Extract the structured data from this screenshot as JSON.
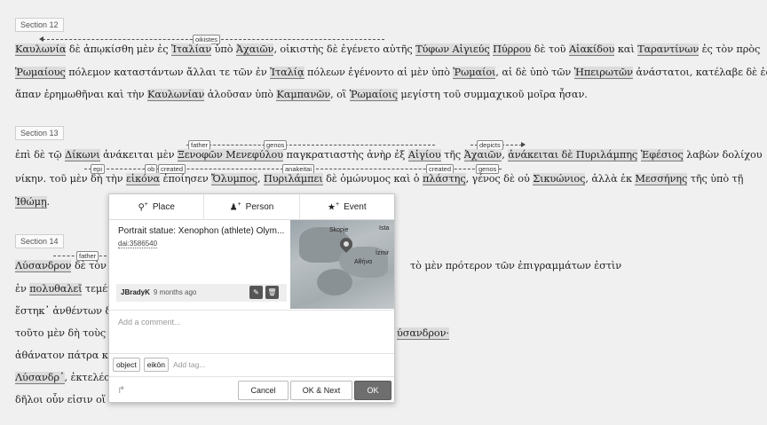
{
  "sections": [
    {
      "label": "Section 12"
    },
    {
      "label": "Section 13"
    },
    {
      "label": "Section 14"
    }
  ],
  "s12": {
    "l1": {
      "w1": "Καυλωνία",
      "t1": " δὲ ἀπῳκίσθη μὲν ἐς ",
      "w2": "Ἰταλίαν",
      "t2": " ὑπὸ ",
      "w3": "Ἀχαιῶν",
      "t3": ", οἰκιστὴς δὲ ἐγένετο αὐτῆς ",
      "w4": "Τύφων Αἰγιεύς",
      "t4": " ",
      "w5": "Πύρρου",
      "t5": " δὲ τοῦ ",
      "w6": "Αἰακίδου",
      "t6": " καὶ ",
      "w7": "Ταραντίνων",
      "t7": " ἐς τὸν πρὸς"
    },
    "l2": {
      "w1": "Ῥωμαίους",
      "t1": " πόλεμον καταστάντων ἄλλαι τε τῶν ἐν ",
      "w2": "Ἰταλίᾳ",
      "t2": " πόλεων ἐγένοντο αἱ μὲν ὑπὸ ",
      "w3": "Ῥωμαίοι",
      "t3": ", αἱ δὲ ὑπὸ τῶν ",
      "w4": "Ἠπειρωτῶν",
      "t4": " ἀνάστατοι, κατέλαβε δὲ ἐς"
    },
    "l3": {
      "t0": "ἅπαν ἐρημωθῆναι καὶ τὴν ",
      "w1": "Καυλωνίαν",
      "t1": " ἁλοῦσαν ὑπὸ ",
      "w2": "Καμπανῶν",
      "t2": ", οἳ ",
      "w3": "Ῥωμαίοις",
      "t3": " μεγίστη τοῦ συμμαχικοῦ μοῖρα ἦσαν."
    },
    "tag": "oikistes"
  },
  "s13": {
    "l1": {
      "t0": "ἐπὶ δὲ τῷ ",
      "w1": "Δίκωνι",
      "t1": " ἀνάκειται μὲν ",
      "w2": "Ξενοφῶν Μενεφύλου",
      "t2": " παγκρατιαστὴς ἀνὴρ ἐξ ",
      "w3": "Αἰγίου",
      "t3": " τῆς ",
      "w4": "Ἀχαιῶν",
      "t4": ", ",
      "w5": "ἀνάκειται δὲ Πυριλάμπης",
      "t5": " ",
      "w6": "Ἐφέσιος",
      "t6": " λαβὼν δολίχου"
    },
    "l2": {
      "t0": "νίκην. τοῦ μὲν δὴ τὴν ",
      "w1": "εἰκόνα",
      "t1": " ἐποίησεν ",
      "w2": "Ὄλυμπος",
      "t2": ", ",
      "w3": "Πυριλάμπει",
      "t3": " δὲ ὁμώνυμος καὶ ὁ ",
      "w4": "πλάστης",
      "t4": ", γένος δὲ οὐ ",
      "w5": "Σικυώνιος",
      "t5": ", ἀλλὰ ἐκ ",
      "w6": "Μεσσήνης",
      "t6": " τῆς ὑπὸ τῇ"
    },
    "l3": {
      "w1": "Ἰθώμῃ",
      "t1": "."
    },
    "tags": {
      "father": "father",
      "genos": "genos",
      "depicts": "depicts",
      "epi": "epi",
      "ob": "ob",
      "created": "created",
      "anakeitai": "anakeitai",
      "created2": "created",
      "genos2": "genos"
    }
  },
  "s14": {
    "l1": {
      "w1": "Λύσανδρον",
      "t1": " δὲ τὸν ",
      "w2": "Ἀ",
      "tr": "τὸ μὲν πρότερον τῶν ἐπιγραμμάτων ἐστὶν"
    },
    "l2": {
      "t0": "ἐν ",
      "w1": "πολυθαλεῖ",
      "t1": " τεμένει"
    },
    "l3": {
      "t0": "ἕστηκ᾽ ἀνθέντων δημ"
    },
    "l4": {
      "t0": "τοῦτο μὲν δὴ τοὺς τὸ",
      "tr": "ύσανδρον·"
    },
    "l5": {
      "t0": "ἀθάνατον πάτρα καὶ"
    },
    "l6": {
      "w1": "Λύσανδρ᾽",
      "t1": ", ἐκτελέσασ"
    },
    "l7": {
      "t0": "δῆλοι οὖν εἰσιν οἵ τε"
    },
    "tag": "father"
  },
  "popup": {
    "tabs": [
      {
        "label": "Place",
        "icon": "map-marker-icon"
      },
      {
        "label": "Person",
        "icon": "person-icon"
      },
      {
        "label": "Event",
        "icon": "star-icon"
      }
    ],
    "entity": {
      "title": "Portrait statue: Xenophon (athlete) Olym...",
      "id": "dai:3586540",
      "user": "JBradyK",
      "time": "9 months ago"
    },
    "map_labels": {
      "a": "Skopje",
      "b": "Ista",
      "c": "İzmir",
      "d": "Αθήνα"
    },
    "comment_placeholder": "Add a comment...",
    "tags": [
      "object",
      "eikōn"
    ],
    "add_tag_placeholder": "Add tag...",
    "buttons": {
      "cancel": "Cancel",
      "ok_next": "OK & Next",
      "ok": "OK"
    }
  }
}
